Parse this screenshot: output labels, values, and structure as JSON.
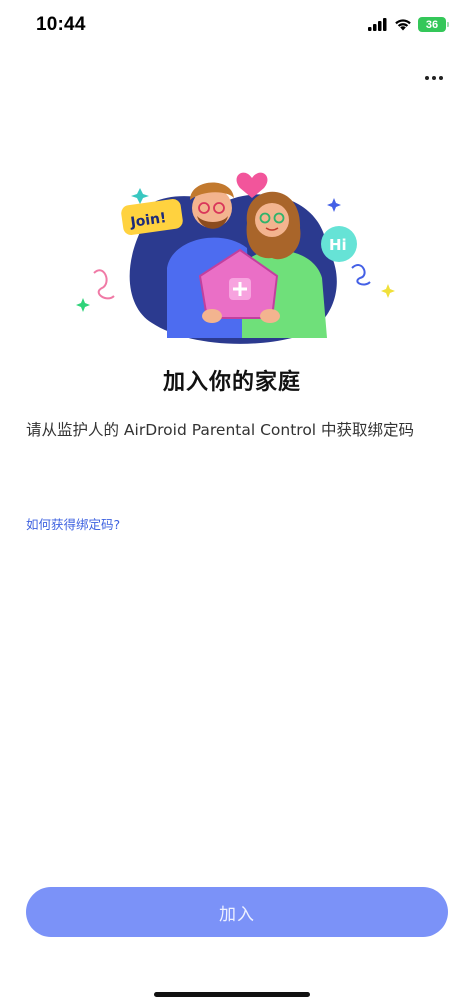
{
  "status_bar": {
    "time": "10:44",
    "battery_level": "36",
    "icons": [
      "cellular-signal-icon",
      "wifi-icon",
      "battery-charging-icon"
    ]
  },
  "header": {
    "more_icon": "more-horizontal-icon"
  },
  "illustration": {
    "join_bubble": "Join!",
    "hi_bubble": "Hi"
  },
  "main": {
    "title": "加入你的家庭",
    "instruction": "请从监护人的 AirDroid Parental Control 中获取绑定码",
    "help_link": "如何获得绑定码?"
  },
  "footer": {
    "join_button": "加入"
  },
  "colors": {
    "primary_button": "#7b92f8",
    "link": "#3e62e0",
    "battery": "#34c759"
  }
}
